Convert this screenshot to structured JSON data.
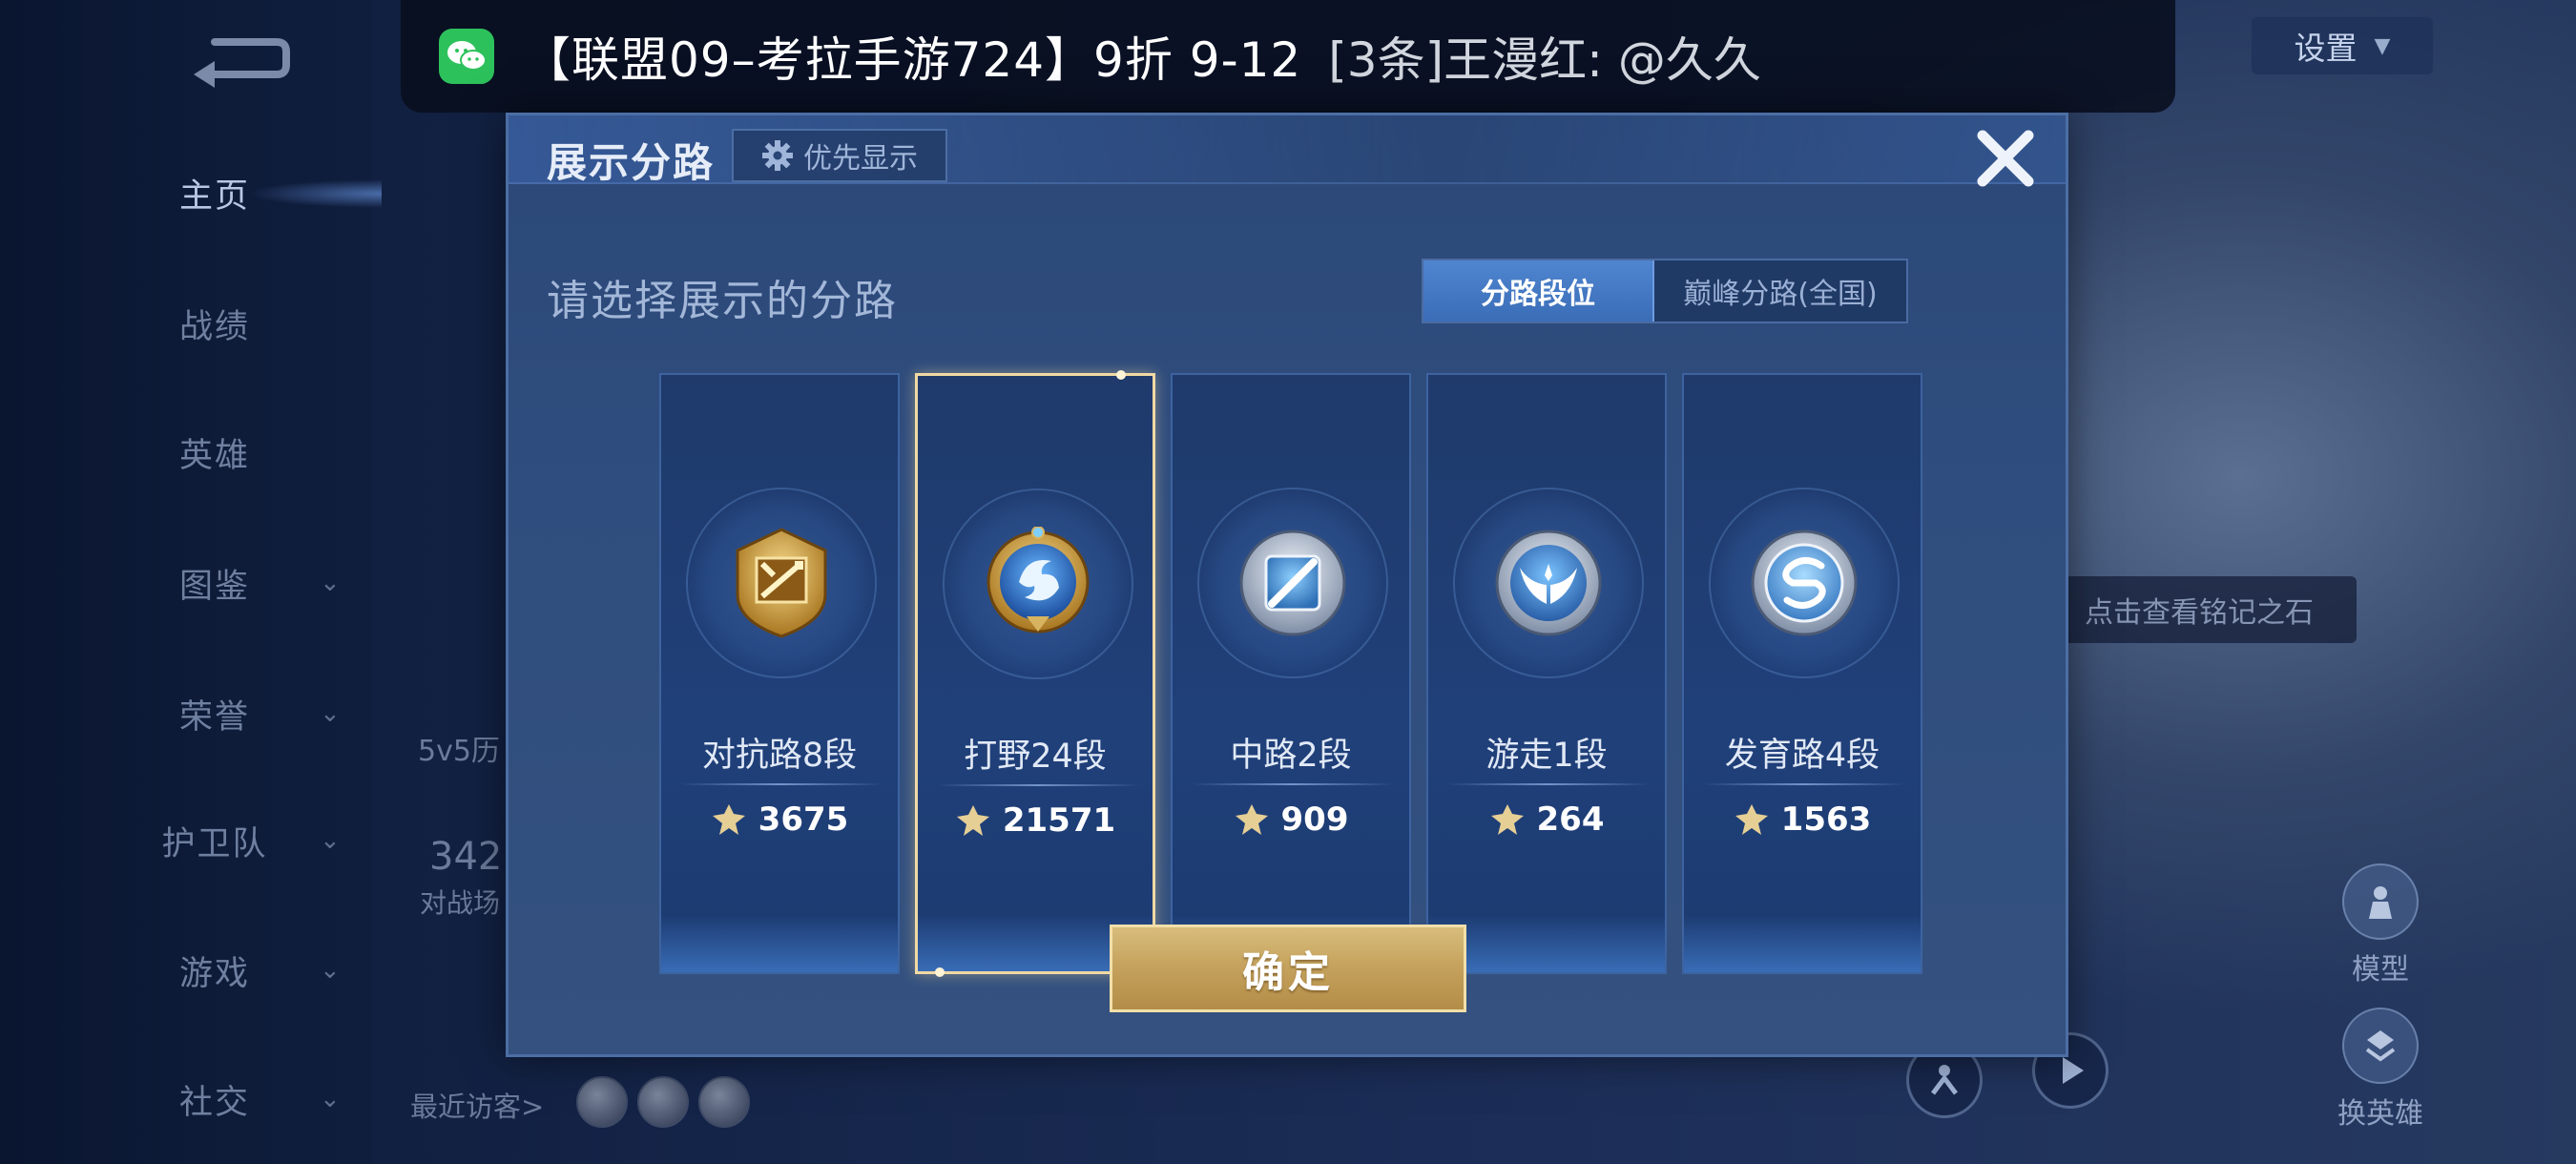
{
  "sidebar": {
    "items": [
      {
        "label": "主页",
        "has_chevron": false,
        "active": true
      },
      {
        "label": "战绩",
        "has_chevron": false
      },
      {
        "label": "英雄",
        "has_chevron": false
      },
      {
        "label": "图鉴",
        "has_chevron": true
      },
      {
        "label": "荣誉",
        "has_chevron": true
      },
      {
        "label": "护卫队",
        "has_chevron": true
      },
      {
        "label": "游戏",
        "has_chevron": true
      },
      {
        "label": "社交",
        "has_chevron": true
      }
    ]
  },
  "background": {
    "history_text": "5v5历",
    "stat_number": "342",
    "stat_label": "对战场",
    "recent_visitors_label": "最近访客>",
    "settings_label": "设置",
    "inscription_tip": "点击查看铭记之石",
    "model_label": "模型",
    "switch_hero_label": "换英雄"
  },
  "notification": {
    "title": "【联盟09–考拉手游724】9折 9-12",
    "body": "[3条]王漫红: @久久"
  },
  "modal": {
    "title": "展示分路",
    "priority_button": "优先显示",
    "subtitle": "请选择展示的分路",
    "toggle": {
      "option_1": "分路段位",
      "option_2": "巅峰分路(全国)",
      "selected": "分路段位"
    },
    "lanes": [
      {
        "label": "对抗路8段",
        "score": "3675",
        "emblem": "sword-emblem-icon",
        "tier": "gold",
        "selected": false
      },
      {
        "label": "打野24段",
        "score": "21571",
        "emblem": "dragon-emblem-icon",
        "tier": "gold-blue",
        "selected": true
      },
      {
        "label": "中路2段",
        "score": "909",
        "emblem": "staff-emblem-icon",
        "tier": "silver",
        "selected": false
      },
      {
        "label": "游走1段",
        "score": "264",
        "emblem": "wings-emblem-icon",
        "tier": "silver",
        "selected": false
      },
      {
        "label": "发育路4段",
        "score": "1563",
        "emblem": "bow-emblem-icon",
        "tier": "silver",
        "selected": false
      }
    ],
    "confirm_button": "确定"
  },
  "colors": {
    "modal_bg": "#2f4d7e",
    "accent_gold": "#c4a15c",
    "selected_border": "#f0d9a3",
    "wechat_green": "#2dc15c"
  }
}
